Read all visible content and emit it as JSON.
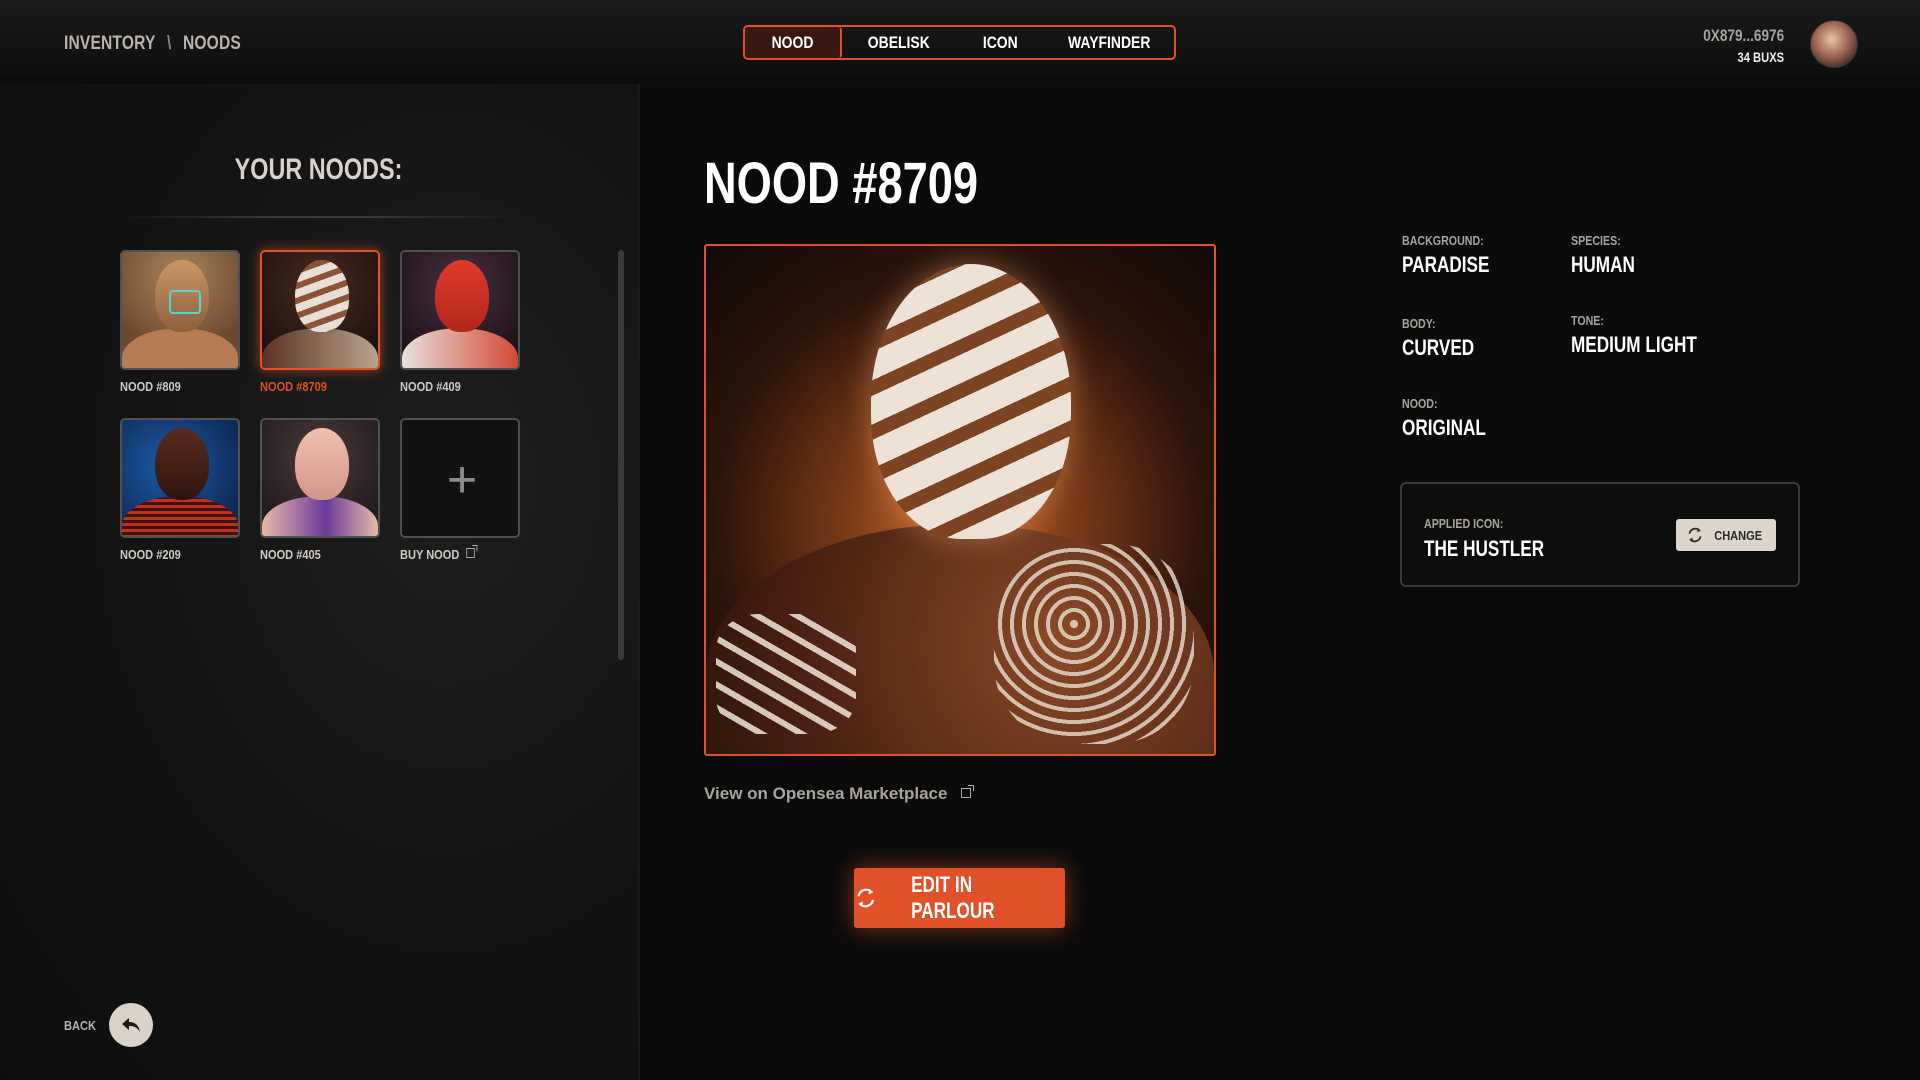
{
  "breadcrumb": {
    "root": "INVENTORY",
    "separator": "\\",
    "current": "NOODS"
  },
  "tabs": [
    {
      "label": "NOOD",
      "active": true
    },
    {
      "label": "OBELISK",
      "active": false
    },
    {
      "label": "ICON",
      "active": false
    },
    {
      "label": "WAYFINDER",
      "active": false
    }
  ],
  "user": {
    "address": "0X879...6976",
    "balance": "34 BUXS"
  },
  "sidebar": {
    "heading": "YOUR NOODS:",
    "items": [
      {
        "label": "NOOD #809",
        "selected": false
      },
      {
        "label": "NOOD #8709",
        "selected": true
      },
      {
        "label": "NOOD #409",
        "selected": false
      },
      {
        "label": "NOOD #209",
        "selected": false
      },
      {
        "label": "NOOD #405",
        "selected": false
      }
    ],
    "buy": {
      "label": "BUY NOOD",
      "icon": "plus-icon"
    }
  },
  "back": {
    "label": "BACK",
    "icon": "back-arrow-icon"
  },
  "main": {
    "title": "NOOD #8709",
    "opensea_link": "View on Opensea Marketplace",
    "edit_button": "EDIT IN PARLOUR"
  },
  "attributes": {
    "background": {
      "key": "BACKGROUND:",
      "value": "PARADISE"
    },
    "species": {
      "key": "SPECIES:",
      "value": "HUMAN"
    },
    "body": {
      "key": "BODY:",
      "value": "CURVED"
    },
    "tone": {
      "key": "TONE:",
      "value": "MEDIUM LIGHT"
    },
    "nood": {
      "key": "NOOD:",
      "value": "ORIGINAL"
    }
  },
  "applied_icon": {
    "key": "APPLIED ICON:",
    "value": "THE HUSTLER",
    "change_label": "CHANGE"
  },
  "colors": {
    "accent": "#e0512a",
    "background": "#0b0b0b",
    "muted_text": "#a9a39d"
  }
}
